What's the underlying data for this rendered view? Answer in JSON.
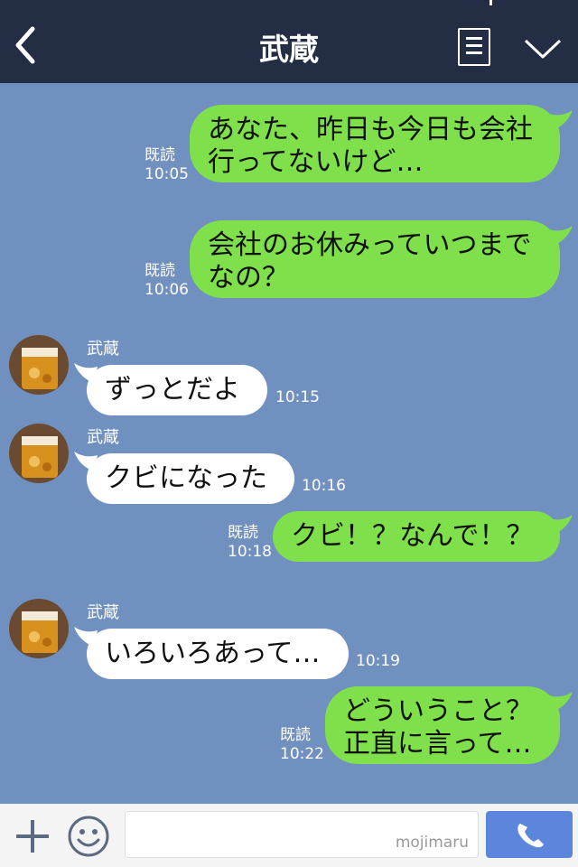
{
  "header": {
    "title": "武蔵"
  },
  "messages": [
    {
      "dir": "out",
      "lines": [
        "あなた、昨日も今日も会社",
        "行ってないけど…"
      ],
      "read": "既読",
      "time": "10:05"
    },
    {
      "dir": "out",
      "lines": [
        "会社のお休みっていつまで",
        "なの？"
      ],
      "read": "既読",
      "time": "10:06"
    },
    {
      "dir": "in",
      "sender": "武蔵",
      "text": "ずっとだよ",
      "time": "10:15"
    },
    {
      "dir": "in",
      "sender": "武蔵",
      "text": "クビになった",
      "time": "10:16"
    },
    {
      "dir": "out",
      "lines": [
        "クビ！？なんで！？"
      ],
      "read": "既読",
      "time": "10:18"
    },
    {
      "dir": "in",
      "sender": "武蔵",
      "text": "いろいろあって…",
      "time": "10:19"
    },
    {
      "dir": "out",
      "lines": [
        "どういうこと？",
        "正直に言って…"
      ],
      "read": "既読",
      "time": "10:22"
    }
  ],
  "input": {
    "watermark": "mojimaru"
  },
  "colors": {
    "header_bg": "#232d44",
    "chat_bg": "#7090c0",
    "outgoing_bubble": "#7fe04c",
    "incoming_bubble": "#ffffff",
    "call_button": "#5b86dc"
  },
  "icons": {
    "back": "chevron-left-icon",
    "menu": "menu-icon",
    "collapse": "chevron-down-icon",
    "add": "plus-icon",
    "emoji": "smiley-icon",
    "call": "phone-icon"
  }
}
